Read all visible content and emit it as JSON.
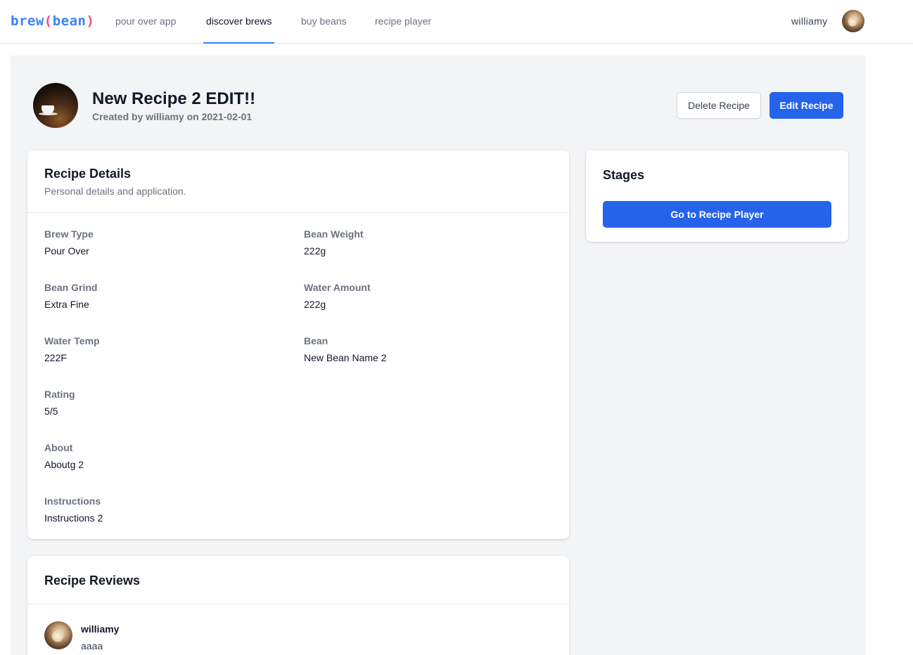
{
  "nav": {
    "logo_part1": "brew",
    "logo_paren_open": "(",
    "logo_part2": "bean",
    "logo_paren_close": ")",
    "links": [
      {
        "label": "pour over app",
        "active": false
      },
      {
        "label": "discover brews",
        "active": true
      },
      {
        "label": "buy beans",
        "active": false
      },
      {
        "label": "recipe player",
        "active": false
      }
    ],
    "username": "williamy"
  },
  "recipe": {
    "title": "New Recipe 2 EDIT!!",
    "subtitle": "Created by williamy on 2021-02-01",
    "delete_label": "Delete Recipe",
    "edit_label": "Edit Recipe"
  },
  "details": {
    "title": "Recipe Details",
    "subtitle": "Personal details and application.",
    "fields": {
      "brew_type": {
        "label": "Brew Type",
        "value": "Pour Over"
      },
      "bean_weight": {
        "label": "Bean Weight",
        "value": "222g"
      },
      "bean_grind": {
        "label": "Bean Grind",
        "value": "Extra Fine"
      },
      "water_amount": {
        "label": "Water Amount",
        "value": "222g"
      },
      "water_temp": {
        "label": "Water Temp",
        "value": "222F"
      },
      "bean": {
        "label": "Bean",
        "value": "New Bean Name 2"
      },
      "rating": {
        "label": "Rating",
        "value": "5/5"
      },
      "about": {
        "label": "About",
        "value": "Aboutg 2"
      },
      "instructions": {
        "label": "Instructions",
        "value": "Instructions 2"
      }
    }
  },
  "stages": {
    "title": "Stages",
    "button_label": "Go to Recipe Player"
  },
  "reviews": {
    "title": "Recipe Reviews",
    "items": [
      {
        "author": "williamy",
        "text": "aaaa"
      }
    ]
  },
  "colors": {
    "accent": "#2563eb",
    "logo_blue": "#3b82f6",
    "logo_pink": "#ec4899",
    "panel_bg": "#f3f4f6"
  }
}
